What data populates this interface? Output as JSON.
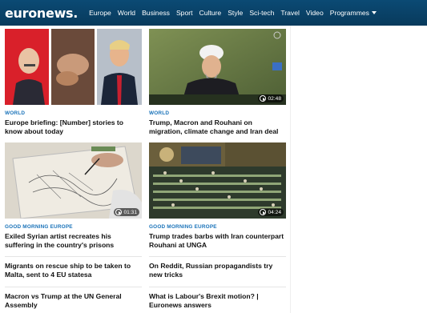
{
  "header": {
    "logo": "euronews.",
    "nav": [
      "Europe",
      "World",
      "Business",
      "Sport",
      "Culture",
      "Style",
      "Sci-tech",
      "Travel",
      "Video",
      "Programmes"
    ]
  },
  "cards": [
    {
      "category": "WORLD",
      "headline": "Europe briefing: [Number] stories to know about today",
      "duration": ""
    },
    {
      "category": "WORLD",
      "headline": "Trump, Macron and Rouhani on migration, climate change and Iran deal",
      "duration": "02:48"
    },
    {
      "category": "GOOD MORNING EUROPE",
      "headline": "Exiled Syrian artist recreates his suffering in the country's prisons",
      "duration": "01:31"
    },
    {
      "category": "GOOD MORNING EUROPE",
      "headline": "Trump trades barbs with Iran counterpart Rouhani at UNGA",
      "duration": "04:24"
    }
  ],
  "list": [
    "Migrants on rescue ship to be taken to Malta, sent to 4 EU statesa",
    "On Reddit, Russian propagandists try new tricks",
    "Macron vs Trump at the UN General Assembly",
    "What is Labour's Brexit motion? | Euronews answers"
  ],
  "colors": {
    "header": "#0a3d62",
    "category": "#1a73b9"
  }
}
